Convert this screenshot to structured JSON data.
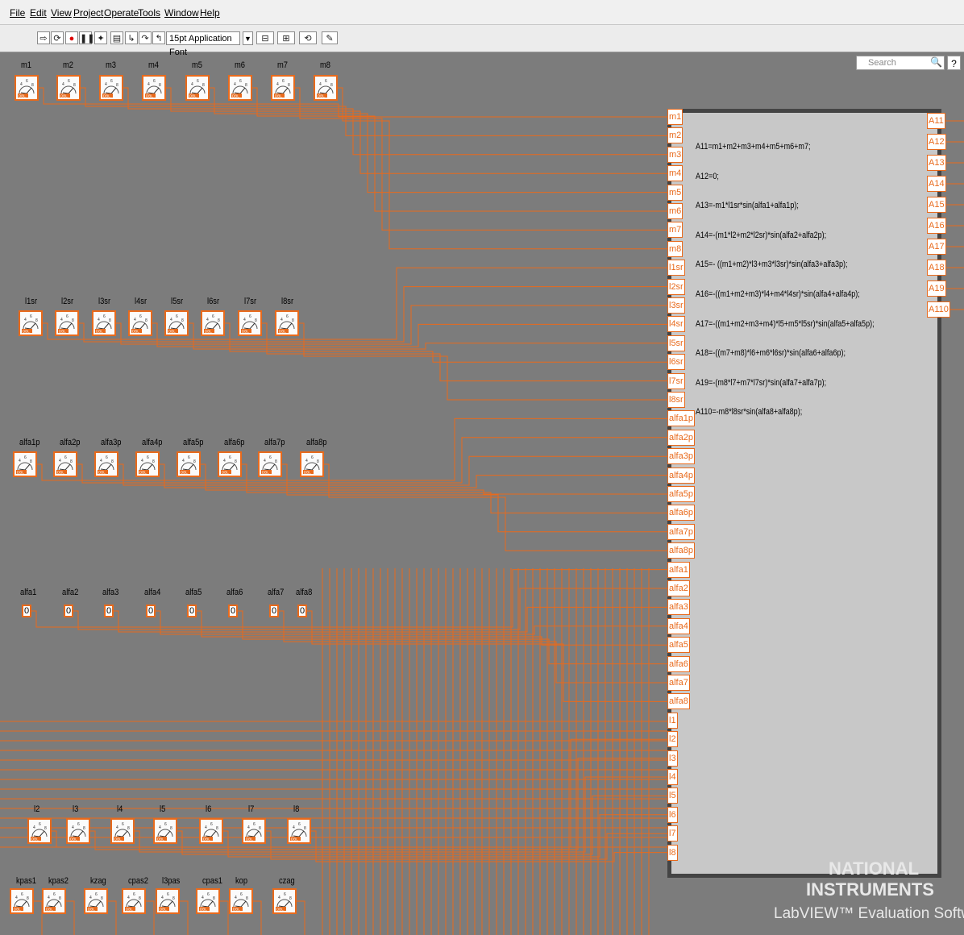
{
  "menubar": {
    "items": [
      "File",
      "Edit",
      "View",
      "Project",
      "Operate",
      "Tools",
      "Window",
      "Help"
    ]
  },
  "toolbar": {
    "font_ring": "15pt Application Font",
    "search_placeholder": "Search",
    "help_label": "?"
  },
  "colors": {
    "wire": "#e86a1c",
    "canvas": "#7c7c7c",
    "formula_bg": "#c8c8c8"
  },
  "controls": {
    "row_m": [
      "m1",
      "m2",
      "m3",
      "m4",
      "m5",
      "m6",
      "m7",
      "m8"
    ],
    "row_lsr": [
      "l1sr",
      "l2sr",
      "l3sr",
      "l4sr",
      "l5sr",
      "l6sr",
      "l7sr",
      "l8sr"
    ],
    "row_alfap": [
      "alfa1p",
      "alfa2p",
      "alfa3p",
      "alfa4p",
      "alfa5p",
      "alfa6p",
      "alfa7p",
      "alfa8p"
    ],
    "row_alfa": [
      "alfa1",
      "alfa2",
      "alfa3",
      "alfa4",
      "alfa5",
      "alfa6",
      "alfa7",
      "alfa8"
    ],
    "alfa_value": "0",
    "row_l": [
      "l2",
      "l3",
      "l4",
      "l5",
      "l6",
      "l7",
      "l8"
    ],
    "row_misc": [
      "kpas1",
      "kpas2",
      "kzag",
      "cpas2",
      "l3pas",
      "cpas1",
      "kop",
      "czag"
    ],
    "knob_badge": "DBL"
  },
  "formula_node": {
    "inputs": [
      "m1",
      "m2",
      "m3",
      "m4",
      "m5",
      "m6",
      "m7",
      "m8",
      "l1sr",
      "l2sr",
      "l3sr",
      "l4sr",
      "l5sr",
      "l6sr",
      "l7sr",
      "l8sr",
      "alfa1p",
      "alfa2p",
      "alfa3p",
      "alfa4p",
      "alfa5p",
      "alfa6p",
      "alfa7p",
      "alfa8p",
      "alfa1",
      "alfa2",
      "alfa3",
      "alfa4",
      "alfa5",
      "alfa6",
      "alfa7",
      "alfa8",
      "l1",
      "l2",
      "l3",
      "l4",
      "l5",
      "l6",
      "l7",
      "l8"
    ],
    "outputs": [
      "A11",
      "A12",
      "A13",
      "A14",
      "A15",
      "A16",
      "A17",
      "A18",
      "A19",
      "A110"
    ],
    "lines": [
      "A11=m1+m2+m3+m4+m5+m6+m7;",
      "A12=0;",
      "A13=-m1*l1sr*sin(alfa1+alfa1p);",
      "A14=-(m1*l2+m2*l2sr)*sin(alfa2+alfa2p);",
      "A15=- ((m1+m2)*l3+m3*l3sr)*sin(alfa3+alfa3p);",
      "A16=-((m1+m2+m3)*l4+m4*l4sr)*sin(alfa4+alfa4p);",
      "A17=-((m1+m2+m3+m4)*l5+m5*l5sr)*sin(alfa5+alfa5p);",
      "A18=-((m7+m8)*l6+m6*l6sr)*sin(alfa6+alfa6p);",
      "A19=-(m8*l7+m7*l7sr)*sin(alfa7+alfa7p);",
      "A110=-m8*l8sr*sin(alfa8+alfa8p);"
    ]
  },
  "watermark": {
    "line1": "NATIONAL",
    "line2": "INSTRUMENTS",
    "line3": "LabVIEW™ Evaluation Software"
  }
}
